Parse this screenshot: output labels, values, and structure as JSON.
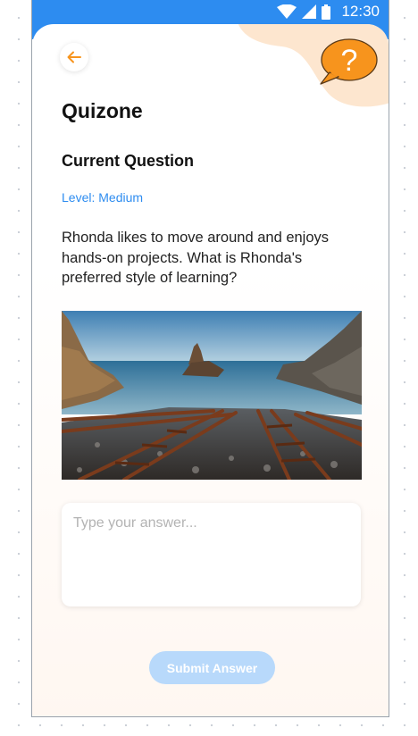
{
  "status_bar": {
    "time": "12:30",
    "icons": [
      "wifi-icon",
      "signal-icon",
      "battery-icon"
    ]
  },
  "header": {
    "back_icon": "arrow-left-icon",
    "help_icon": "question-mark-icon"
  },
  "app": {
    "title": "Quizone"
  },
  "question": {
    "section_title": "Current Question",
    "level": "Level: Medium",
    "text": "Rhonda likes to move around and enjoys hands-on projects. What is Rhonda's preferred style of learning?",
    "image": "coastal-rocks-rusty-rails-photo"
  },
  "answer": {
    "value": "",
    "placeholder": "Type your answer..."
  },
  "submit": {
    "label": "Submit Answer"
  },
  "colors": {
    "accent": "#2d8cf0",
    "orange": "#f7941d",
    "button_disabled": "#b8d9fb"
  }
}
